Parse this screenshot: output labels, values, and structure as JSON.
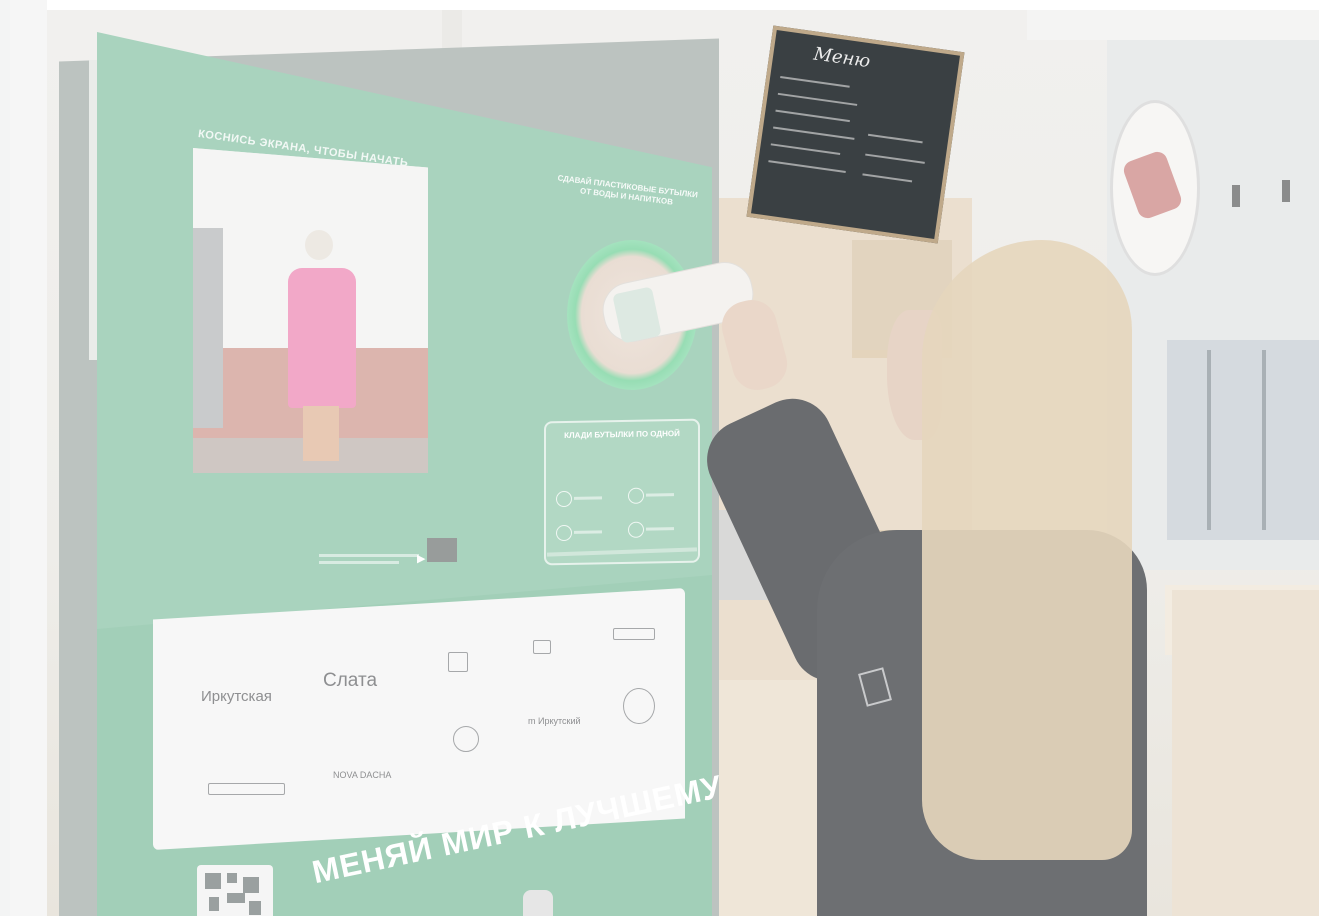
{
  "kiosk": {
    "caption": "КОСНИСЬ ЭКРАНА, ЧТОБЫ НАЧАТЬ",
    "intake_label": "СДАВАЙ ПЛАСТИКОВЫЕ БУТЫЛКИ ОТ ВОДЫ И НАПИТКОВ",
    "rules_title": "КЛАДИ БУТЫЛКИ ПО ОДНОЙ",
    "slogan": "МЕНЯЙ МИР К ЛУЧШЕМУ"
  },
  "sponsors": {
    "irkutskaya": "Иркутская",
    "slata": "Слата",
    "nova_dacha": "NOVA DACHA",
    "irkutsk_m": "m Иркутский"
  },
  "menu_board": {
    "title": "Меню"
  }
}
